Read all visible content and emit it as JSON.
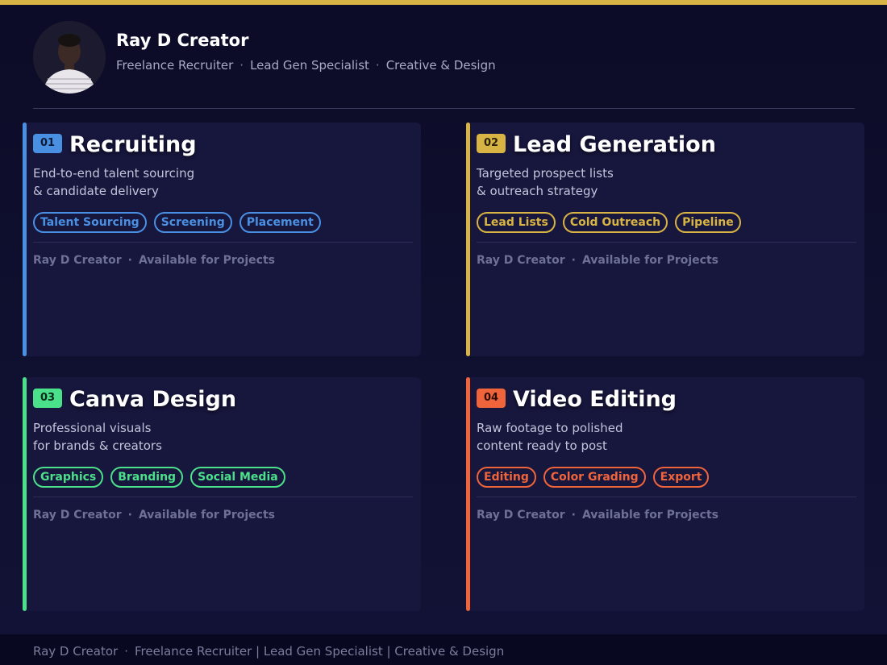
{
  "profile": {
    "name": "Ray D Creator",
    "roles": [
      "Freelance Recruiter",
      "Lead Gen Specialist",
      "Creative & Design"
    ],
    "separator": "·"
  },
  "cards": [
    {
      "number": "01",
      "title": "Recruiting",
      "description": [
        "End-to-end talent sourcing",
        "& candidate delivery"
      ],
      "tags": [
        "Talent Sourcing",
        "Screening",
        "Placement"
      ],
      "footer_name": "Ray D Creator",
      "footer_status": "Available for Projects",
      "accent": "#4a90e2",
      "badge_text_color": "#0d1b3a"
    },
    {
      "number": "02",
      "title": "Lead Generation",
      "description": [
        "Targeted prospect lists",
        "& outreach strategy"
      ],
      "tags": [
        "Lead Lists",
        "Cold Outreach",
        "Pipeline"
      ],
      "footer_name": "Ray D Creator",
      "footer_status": "Available for Projects",
      "accent": "#d8b444",
      "badge_text_color": "#2a220a"
    },
    {
      "number": "03",
      "title": "Canva Design",
      "description": [
        "Professional visuals",
        "for brands & creators"
      ],
      "tags": [
        "Graphics",
        "Branding",
        "Social Media"
      ],
      "footer_name": "Ray D Creator",
      "footer_status": "Available for Projects",
      "accent": "#4be08a",
      "badge_text_color": "#0b2a18"
    },
    {
      "number": "04",
      "title": "Video Editing",
      "description": [
        "Raw footage to polished",
        "content ready to post"
      ],
      "tags": [
        "Editing",
        "Color Grading",
        "Export"
      ],
      "footer_name": "Ray D Creator",
      "footer_status": "Available for Projects",
      "accent": "#f0643c",
      "badge_text_color": "#2a0d06"
    }
  ],
  "footer": {
    "name": "Ray D Creator",
    "text": "Freelance Recruiter | Lead Gen Specialist | Creative & Design"
  },
  "colors": {
    "top_bar": "#d8b444",
    "background": "#0d0d2b",
    "card": "#17163d"
  },
  "icons": {
    "avatar": "profile-photo"
  }
}
